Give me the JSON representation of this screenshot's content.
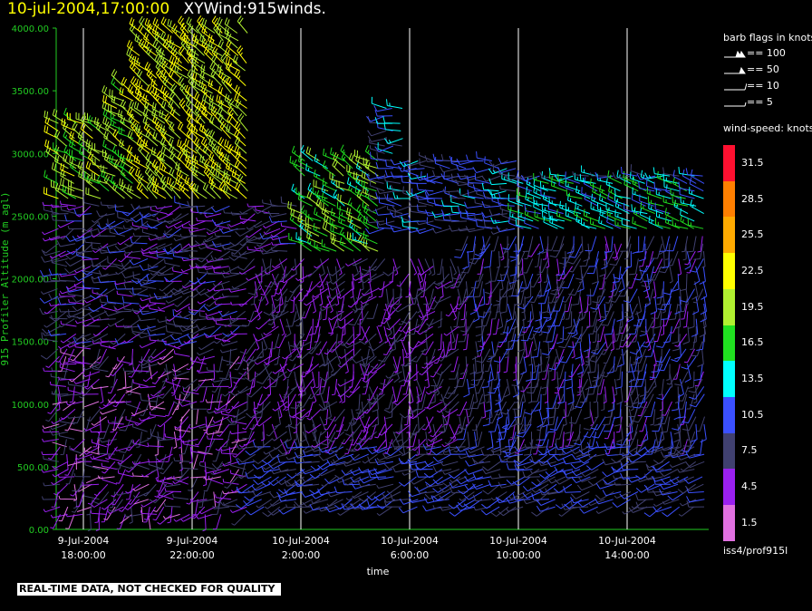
{
  "header": {
    "date": "10-jul-2004,17:00:00",
    "variable": "XYWind:915winds."
  },
  "notice": "REAL-TIME DATA, NOT CHECKED FOR QUALITY",
  "station": "iss4/prof915l",
  "colors": {
    "axis": "#22cc22",
    "grid": "#ffffff",
    "background": "#000000"
  },
  "legend": {
    "flags_title": "barb flags in knots",
    "flags": [
      {
        "label": "== 100",
        "kind": "pennant2"
      },
      {
        "label": "== 50",
        "kind": "pennant"
      },
      {
        "label": "== 10",
        "kind": "full"
      },
      {
        "label": "== 5",
        "kind": "half"
      }
    ],
    "speed_title": "wind-speed: knots",
    "speed_bins": [
      {
        "label": "31.5",
        "color": "#ff1030"
      },
      {
        "label": "28.5",
        "color": "#ff7f00"
      },
      {
        "label": "25.5",
        "color": "#ffaa00"
      },
      {
        "label": "22.5",
        "color": "#ffff00"
      },
      {
        "label": "19.5",
        "color": "#b0f030"
      },
      {
        "label": "16.5",
        "color": "#20e020"
      },
      {
        "label": "13.5",
        "color": "#00ffff"
      },
      {
        "label": "10.5",
        "color": "#3b50ff"
      },
      {
        "label": "7.5",
        "color": "#404070"
      },
      {
        "label": "4.5",
        "color": "#9a20f0"
      },
      {
        "label": "1.5",
        "color": "#e070e0"
      }
    ]
  },
  "chart_data": {
    "type": "scatter",
    "subtype": "wind-barb time-height",
    "ylabel": "915 Profiler Altitude (m agl)",
    "xlabel": "time",
    "ylim": [
      0,
      4000
    ],
    "yticks": [
      "0.00",
      "500.00",
      "1000.00",
      "1500.00",
      "2000.00",
      "2500.00",
      "3000.00",
      "3500.00",
      "4000.00"
    ],
    "xticks": [
      {
        "date": "9-Jul-2004",
        "time": "18:00:00"
      },
      {
        "date": "9-Jul-2004",
        "time": "22:00:00"
      },
      {
        "date": "10-Jul-2004",
        "time": "2:00:00"
      },
      {
        "date": "10-Jul-2004",
        "time": "6:00:00"
      },
      {
        "date": "10-Jul-2004",
        "time": "10:00:00"
      },
      {
        "date": "10-Jul-2004",
        "time": "14:00:00"
      }
    ],
    "xrange_hours": [
      -1,
      23
    ],
    "grid": "vertical lines at each time tick",
    "regimes": [
      {
        "t_start": -1,
        "t_end": 6,
        "alt_min": 0,
        "alt_max": 1500,
        "dir_deg": 230,
        "speed_kt": 5,
        "spread_deg": 120
      },
      {
        "t_start": -1,
        "t_end": 8,
        "alt_min": 1500,
        "alt_max": 2600,
        "dir_deg": 255,
        "speed_kt": 7,
        "spread_deg": 60
      },
      {
        "t_start": -1,
        "t_end": 3,
        "alt_min": 2600,
        "alt_max": 3600,
        "dir_deg": 300,
        "speed_kt": 19,
        "spread_deg": 30
      },
      {
        "t_start": 2,
        "t_end": 6,
        "alt_min": 2600,
        "alt_max": 4000,
        "dir_deg": 310,
        "speed_kt": 21,
        "spread_deg": 25
      },
      {
        "t_start": 8,
        "t_end": 11,
        "alt_min": 2200,
        "alt_max": 3000,
        "dir_deg": 300,
        "speed_kt": 17,
        "spread_deg": 30
      },
      {
        "t_start": 6,
        "t_end": 23,
        "alt_min": 150,
        "alt_max": 700,
        "dir_deg": 250,
        "speed_kt": 9,
        "spread_deg": 40
      },
      {
        "t_start": 6,
        "t_end": 14,
        "alt_min": 700,
        "alt_max": 2200,
        "dir_deg": 200,
        "speed_kt": 6,
        "spread_deg": 90
      },
      {
        "t_start": 14,
        "t_end": 23,
        "alt_min": 700,
        "alt_max": 2400,
        "dir_deg": 190,
        "speed_kt": 8,
        "spread_deg": 50
      },
      {
        "t_start": 11,
        "t_end": 23,
        "alt_min": 2400,
        "alt_max": 3400,
        "dir_deg": 270,
        "speed_kt": 10,
        "spread_deg": 45
      },
      {
        "t_start": 16,
        "t_end": 23,
        "alt_min": 2400,
        "alt_max": 2800,
        "dir_deg": 290,
        "speed_kt": 14,
        "spread_deg": 20
      }
    ]
  }
}
